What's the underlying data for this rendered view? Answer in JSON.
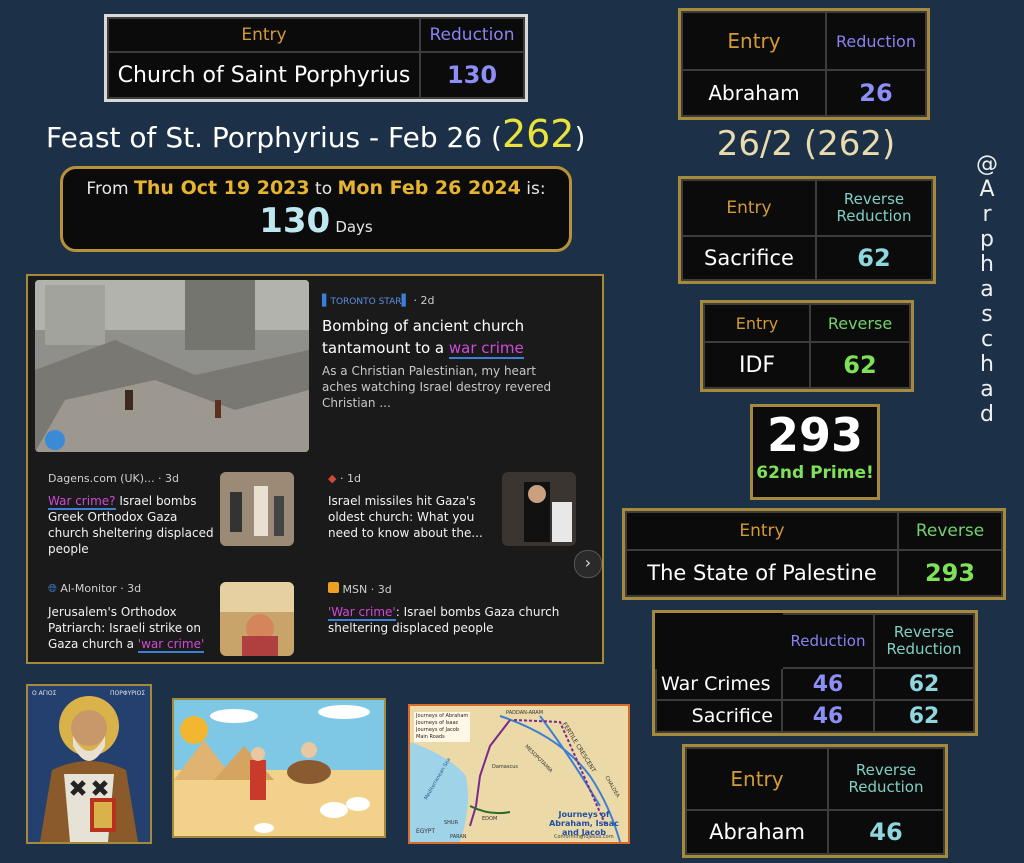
{
  "table_church": {
    "h_entry": "Entry",
    "h_val": "Reduction",
    "entry": "Church of Saint Porphyrius",
    "value": "130"
  },
  "feast": {
    "text": "Feast of St. Porphyrius - Feb 26 (",
    "num": "262",
    "close": ")"
  },
  "days": {
    "from": "From",
    "d1": "Thu Oct 19 2023",
    "to": "to",
    "d2": "Mon Feb 26 2024",
    "is": "is:",
    "num": "130",
    "unit": "Days"
  },
  "table_abraham1": {
    "h_entry": "Entry",
    "h_val": "Reduction",
    "entry": "Abraham",
    "value": "26"
  },
  "ratio": "26/2 (262)",
  "table_sacrifice": {
    "h_entry": "Entry",
    "h_val": "Reverse\nReduction",
    "entry": "Sacrifice",
    "value": "62"
  },
  "table_idf": {
    "h_entry": "Entry",
    "h_val": "Reverse",
    "entry": "IDF",
    "value": "62"
  },
  "prime": {
    "num": "293",
    "label": "62nd Prime!"
  },
  "table_palestine": {
    "h_entry": "Entry",
    "h_val": "Reverse",
    "entry": "The State of Palestine",
    "value": "293"
  },
  "table_war": {
    "h1": "Reduction",
    "h2": "Reverse\nReduction",
    "rows": [
      {
        "entry": "War Crimes",
        "v1": "46",
        "v2": "62"
      },
      {
        "entry": "Sacrifice",
        "v1": "46",
        "v2": "62"
      }
    ]
  },
  "table_abraham2": {
    "h_entry": "Entry",
    "h_val": "Reverse\nReduction",
    "entry": "Abraham",
    "value": "46"
  },
  "handle": [
    "@",
    "A",
    "r",
    "p",
    "h",
    "a",
    "s",
    "c",
    "h",
    "a",
    "d"
  ],
  "news": {
    "top": {
      "source": "TORONTO STAR",
      "age": "· 2d",
      "title_a": "Bombing of ancient church tantamount to a ",
      "title_kw": "war crime",
      "snippet": "As a Christian Palestinian, my heart aches watching Israel destroy revered Christian ..."
    },
    "items": [
      {
        "source": "Dagens.com (UK)...",
        "age": "· 3d",
        "kw": "War crime?",
        "title": " Israel bombs Greek Orthodox Gaza church sheltering displaced people"
      },
      {
        "source": "",
        "age": "· 1d",
        "kw": "",
        "title": "Israel missiles hit Gaza's oldest church: What you need to know about the..."
      },
      {
        "source": "Al-Monitor",
        "age": "· 3d",
        "kw": "'war crime'",
        "title": "Jerusalem's Orthodox Patriarch: Israeli strike on Gaza church a "
      },
      {
        "source": "MSN",
        "age": "· 3d",
        "kw": "'War crime'",
        "title": ": Israel bombs Gaza church sheltering displaced people"
      }
    ]
  },
  "icon": {
    "greek_left": "Ο ΑΓΙΟΣ",
    "greek_right": "ΠΟΡΦΥΡΙΟΣ"
  },
  "map": {
    "legend": [
      "Journeys of Abraham",
      "Journeys of Isaac",
      "Journeys of Jacob",
      "Main Roads"
    ],
    "labels": [
      "PADDAN-ARAM",
      "FERTILE CRESCENT",
      "MESOPOTAMIA",
      "Mediterranean Sea",
      "Damascus",
      "EDOM",
      "EGYPT",
      "SHUR",
      "PARAN",
      "CHALDEA"
    ],
    "caption": "Journeys of Abraham, Isaac and Jacob",
    "credit": "ConformingToJesus.com"
  }
}
